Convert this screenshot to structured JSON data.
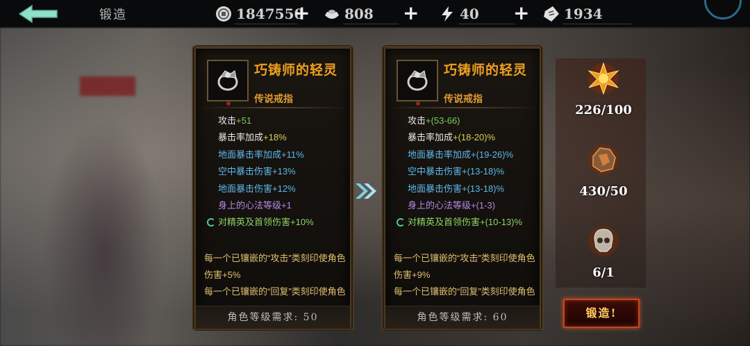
{
  "header": {
    "title": "锻造",
    "resources": [
      {
        "icon": "coin-icon",
        "value": "1847550"
      },
      {
        "icon": "ingot-icon",
        "value": "808"
      },
      {
        "icon": "energy-icon",
        "value": "40"
      },
      {
        "icon": "ticket-icon",
        "value": "1934"
      }
    ],
    "plus_label": "+"
  },
  "current_item": {
    "name": "巧铸师的轻灵",
    "type": "传说戒指",
    "stats": [
      {
        "key": "攻击",
        "value": "+51",
        "tone": "base"
      },
      {
        "key": "暴击率加成",
        "value": "+18%",
        "tone": "yellow"
      },
      {
        "key": "地面暴击率加成",
        "value": "+11%",
        "tone": "blue"
      },
      {
        "key": "空中暴击伤害",
        "value": "+13%",
        "tone": "blue"
      },
      {
        "key": "地面暴击伤害",
        "value": "+12%",
        "tone": "blue"
      },
      {
        "key": "身上的心法等级",
        "value": "+1",
        "tone": "purple"
      },
      {
        "key": "对精英及首领伤害",
        "value": "+10%",
        "tone": "green"
      }
    ],
    "description": "每一个已镶嵌的“攻击”类刻印使角色伤害+5%每一个已镶嵌的“回复”类刻印使角色",
    "description_lines": [
      "每一个已镶嵌的“攻击”类刻印使角色",
      "伤害+5%",
      "每一个已镶嵌的“回复”类刻印使角色"
    ],
    "requirement": "角色等级需求: 50"
  },
  "next_item": {
    "name": "巧铸师的轻灵",
    "type": "传说戒指",
    "stats": [
      {
        "key": "攻击",
        "value": "+(53-66)",
        "tone": "base"
      },
      {
        "key": "暴击率加成",
        "value": "+(18-20)%",
        "tone": "yellow"
      },
      {
        "key": "地面暴击率加成",
        "value": "+(19-26)%",
        "tone": "blue"
      },
      {
        "key": "空中暴击伤害",
        "value": "+(13-18)%",
        "tone": "blue"
      },
      {
        "key": "地面暴击伤害",
        "value": "+(13-18)%",
        "tone": "blue"
      },
      {
        "key": "身上的心法等级",
        "value": "+(1-3)",
        "tone": "purple"
      },
      {
        "key": "对精英及首领伤害",
        "value": "+(10-13)%",
        "tone": "green"
      }
    ],
    "description_lines": [
      "每一个已镶嵌的“攻击”类刻印使角色",
      "伤害+9%",
      "每一个已镶嵌的“回复”类刻印使角色"
    ],
    "requirement": "角色等级需求: 60"
  },
  "materials": [
    {
      "icon": "flame-crystal-icon",
      "count": "226/100"
    },
    {
      "icon": "ore-chunk-icon",
      "count": "430/50"
    },
    {
      "icon": "skull-ore-icon",
      "count": "6/1"
    }
  ],
  "forge_button": "锻造!",
  "colors": {
    "accent_gold": "#f0a020",
    "stat_blue": "#5fb8ea",
    "stat_purple": "#b48ae6",
    "stat_green": "#8ed462",
    "forge_border": "#c2481c"
  }
}
